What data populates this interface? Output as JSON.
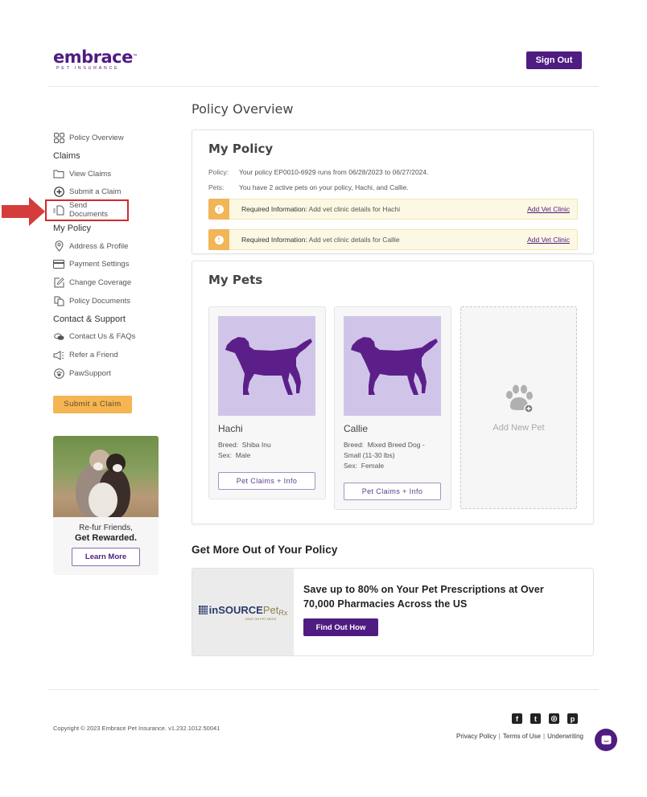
{
  "header": {
    "logo_main": "embrace",
    "logo_sub": "PET INSURANCE",
    "sign_out": "Sign Out"
  },
  "sidebar": {
    "policy_overview": "Policy Overview",
    "claims_heading": "Claims",
    "view_claims": "View Claims",
    "submit_claim": "Submit a Claim",
    "send_documents": "Send Documents",
    "my_policy_heading": "My Policy",
    "address_profile": "Address & Profile",
    "payment_settings": "Payment Settings",
    "change_coverage": "Change Coverage",
    "policy_documents": "Policy Documents",
    "contact_heading": "Contact & Support",
    "contact_faqs": "Contact Us & FAQs",
    "refer_friend": "Refer a Friend",
    "pawsupport": "PawSupport",
    "submit_button": "Submit a Claim"
  },
  "promo": {
    "line1": "Re-fur Friends,",
    "line2": "Get Rewarded.",
    "button": "Learn More"
  },
  "main": {
    "page_title": "Policy Overview",
    "my_policy": {
      "title": "My Policy",
      "policy_label": "Policy:",
      "policy_text": "Your policy EP0010-6929 runs from 06/28/2023 to 06/27/2024.",
      "pets_label": "Pets:",
      "pets_text": "You have 2 active pets on your policy, Hachi, and Callie.",
      "alerts": [
        {
          "label": "Required Information:",
          "text": "Add vet clinic details for Hachi",
          "link": "Add Vet Clinic"
        },
        {
          "label": "Required Information:",
          "text": "Add vet clinic details for Callie",
          "link": "Add Vet Clinic"
        }
      ]
    },
    "my_pets": {
      "title": "My Pets",
      "pets": [
        {
          "name": "Hachi",
          "breed_label": "Breed:",
          "breed": "Shiba Inu",
          "sex_label": "Sex:",
          "sex": "Male",
          "button": "Pet Claims + Info"
        },
        {
          "name": "Callie",
          "breed_label": "Breed:",
          "breed": "Mixed Breed Dog - Small (11-30 lbs)",
          "sex_label": "Sex:",
          "sex": "Female",
          "button": "Pet Claims + Info"
        }
      ],
      "add_new": "Add New Pet"
    },
    "get_more": {
      "title": "Get More Out of Your Policy",
      "partner_logo_main": "inSOURCE",
      "partner_logo_pet": "Pet",
      "partner_logo_rx": "Rx",
      "partner_logo_sub": "SAVE ON PET MEDS",
      "offer_text": "Save up to 80% on Your Pet Prescriptions at Over 70,000 Pharmacies Across the US",
      "button": "Find Out How"
    }
  },
  "footer": {
    "copyright": "Copyright © 2023   Embrace Pet Insurance. v1.232.1012.50041",
    "links": [
      "Privacy Policy",
      "Terms of Use",
      "Underwriting"
    ],
    "social": [
      "facebook",
      "twitter",
      "instagram",
      "pinterest"
    ]
  },
  "colors": {
    "brand_purple": "#4f1c82",
    "accent_yellow": "#f5b553",
    "alert_bg": "#fdf8e3",
    "pet_image_bg": "#d0c5e8",
    "annotation_red": "#d12b2b"
  }
}
